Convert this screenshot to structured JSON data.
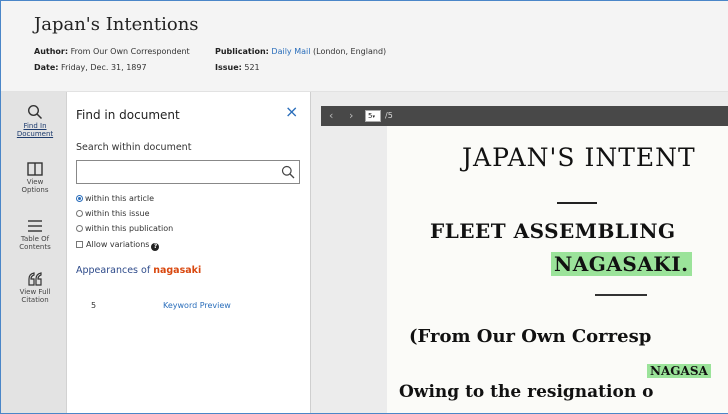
{
  "article": {
    "title": "Japan's Intentions",
    "author_label": "Author:",
    "author_value": "From Our Own Correspondent",
    "date_label": "Date:",
    "date_value": "Friday, Dec. 31, 1897",
    "publication_label": "Publication:",
    "publication_link": "Daily Mail",
    "publication_place": "(London, England)",
    "issue_label": "Issue:",
    "issue_value": "521"
  },
  "rail": {
    "items": [
      {
        "label_line1": "Find In",
        "label_line2": "Document",
        "icon": "search-icon"
      },
      {
        "label_line1": "View",
        "label_line2": "Options",
        "icon": "view-options-icon"
      },
      {
        "label_line1": "Table Of",
        "label_line2": "Contents",
        "icon": "list-icon"
      },
      {
        "label_line1": "View Full",
        "label_line2": "Citation",
        "icon": "quote-icon"
      }
    ]
  },
  "find_panel": {
    "title": "Find in document",
    "close_icon": "×",
    "search_label": "Search within document",
    "search_value": "",
    "search_placeholder": "",
    "options": {
      "within_article": "within this article",
      "within_issue": "within this issue",
      "within_publication": "within this publication",
      "allow_variations": "Allow variations"
    },
    "selected_option": "within_article",
    "appearances_prefix": "Appearances of",
    "appearances_term": "nagasaki",
    "results": [
      {
        "page": "5",
        "link": "Keyword Preview"
      }
    ]
  },
  "viewer": {
    "prev_icon": "‹",
    "next_icon": "›",
    "page_current": "5",
    "page_total": "/5"
  },
  "page_scan": {
    "headline": "JAPAN'S  INTENT",
    "subhead1": "FLEET  ASSEMBLING",
    "subhead2": "NAGASAKI.",
    "byline": "(From  Our  Own  Corresp",
    "place": "NAGASA",
    "body": "Owing to the resignation o"
  },
  "colors": {
    "accent_link": "#2a6ebb",
    "search_term": "#d9480f",
    "highlight": "#9be39a",
    "toolbar": "#484848"
  }
}
